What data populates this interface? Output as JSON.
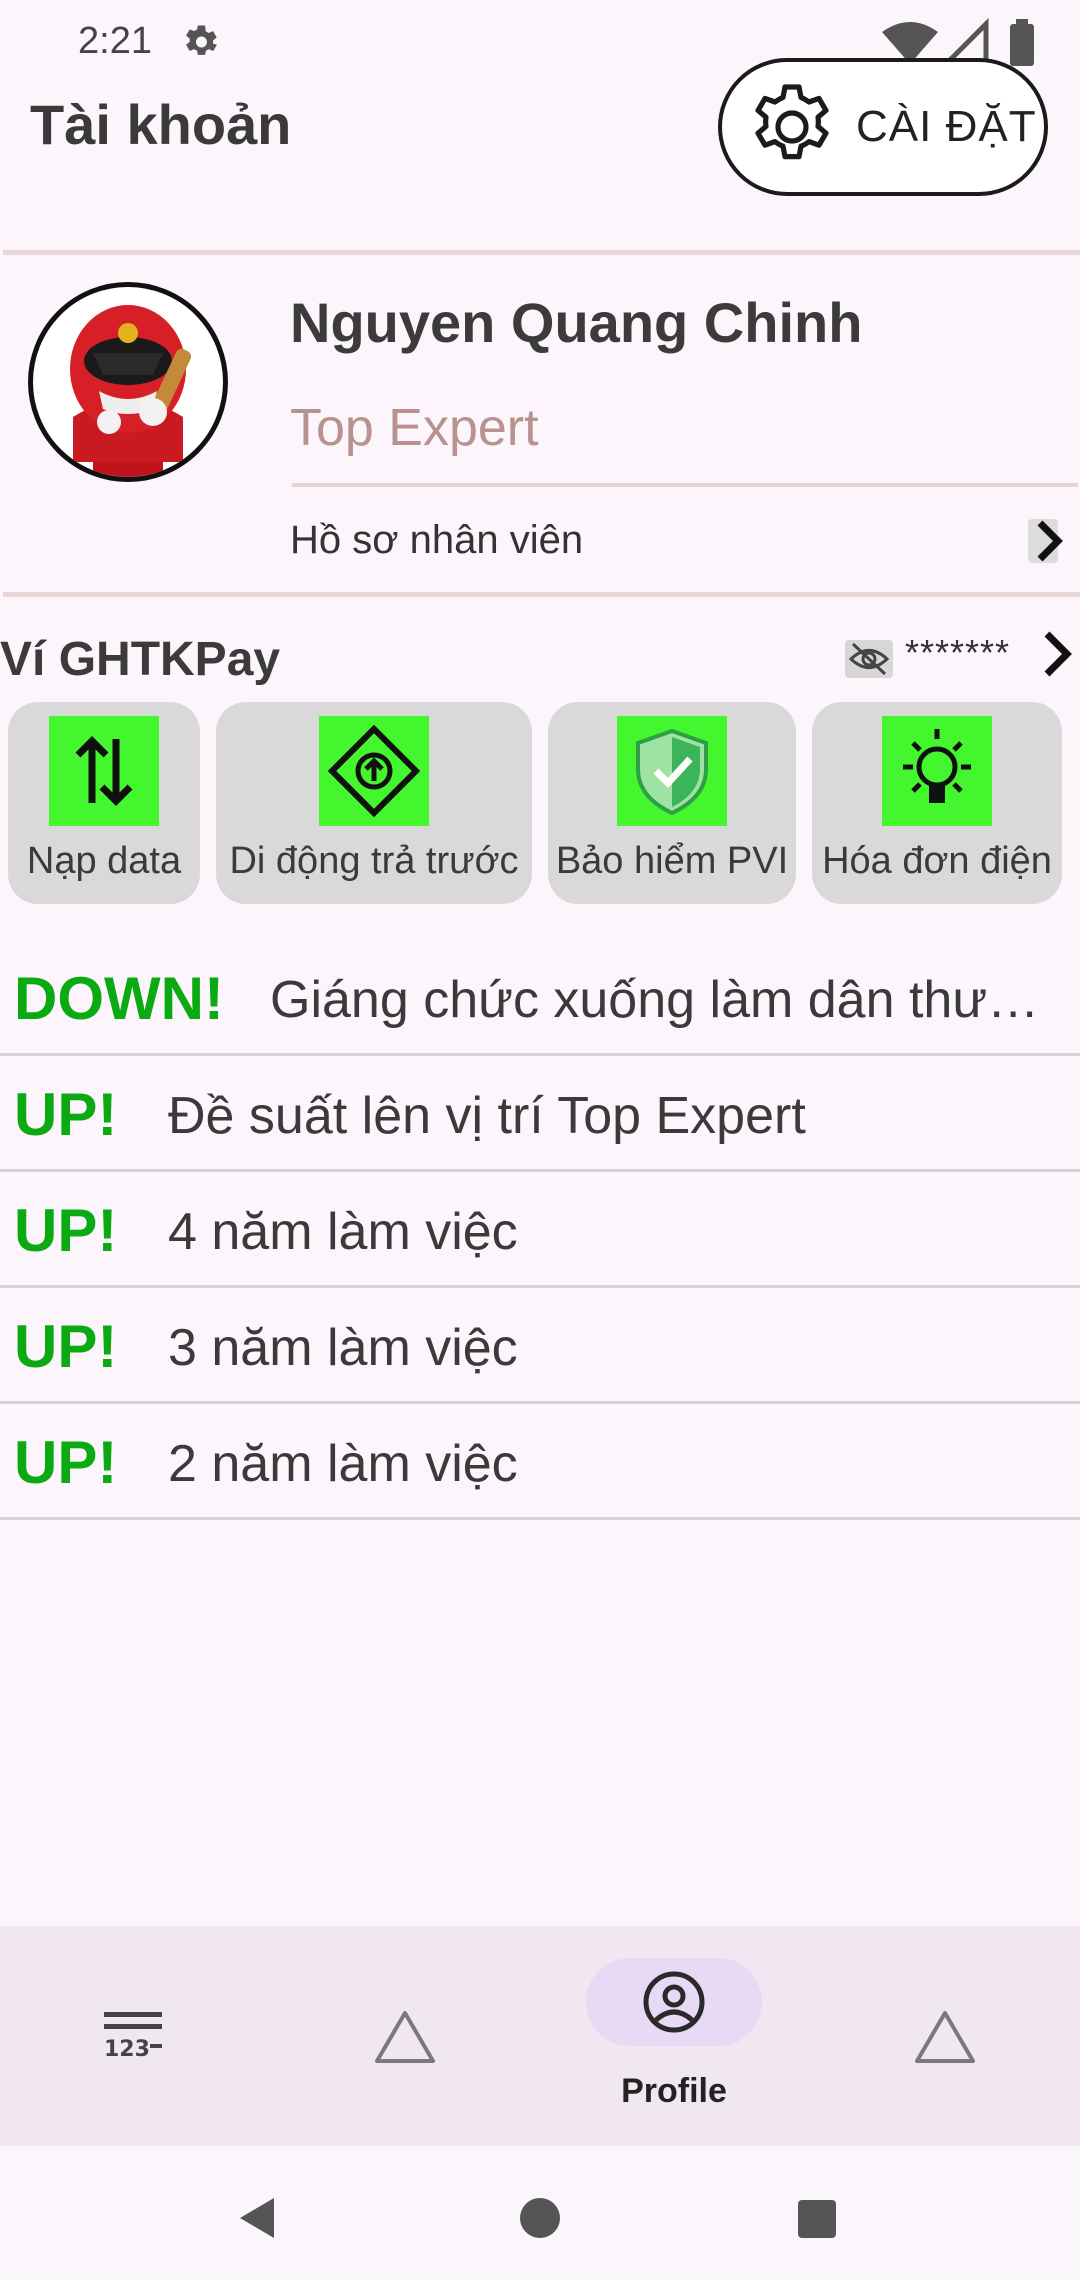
{
  "status_bar": {
    "time": "2:21"
  },
  "header": {
    "title": "Tài khoản",
    "settings_label": "CÀI ĐẶT"
  },
  "profile": {
    "name": "Nguyen Quang Chinh",
    "role": "Top Expert",
    "link_label": "Hồ sơ nhân viên"
  },
  "wallet": {
    "title": "Ví GHTKPay",
    "balance_masked": "*******",
    "services": [
      {
        "label": "Nạp data",
        "icon": "data-transfer-icon"
      },
      {
        "label": "Di động trả trước",
        "icon": "direction-up-sign-icon"
      },
      {
        "label": "Bảo hiểm PVI",
        "icon": "shield-check-icon"
      },
      {
        "label": "Hóa đơn điện",
        "icon": "lightbulb-icon"
      }
    ]
  },
  "notifications": [
    {
      "tag": "DOWN!",
      "text": "Giáng chức xuống làm dân thường"
    },
    {
      "tag": "UP!",
      "text": "Đề suất lên vị trí Top Expert"
    },
    {
      "tag": "UP!",
      "text": "4 năm làm việc"
    },
    {
      "tag": "UP!",
      "text": "3 năm làm việc"
    },
    {
      "tag": "UP!",
      "text": "2 năm làm việc"
    }
  ],
  "bottom_nav": {
    "items": [
      {
        "icon": "numbers-list-icon",
        "label": ""
      },
      {
        "icon": "triangle-icon",
        "label": ""
      },
      {
        "icon": "profile-icon",
        "label": "Profile"
      },
      {
        "icon": "triangle-icon",
        "label": ""
      }
    ]
  },
  "colors": {
    "accent_green": "#0caa12",
    "tile_icon_bg": "#44f62e",
    "background": "#fcf5fb"
  }
}
